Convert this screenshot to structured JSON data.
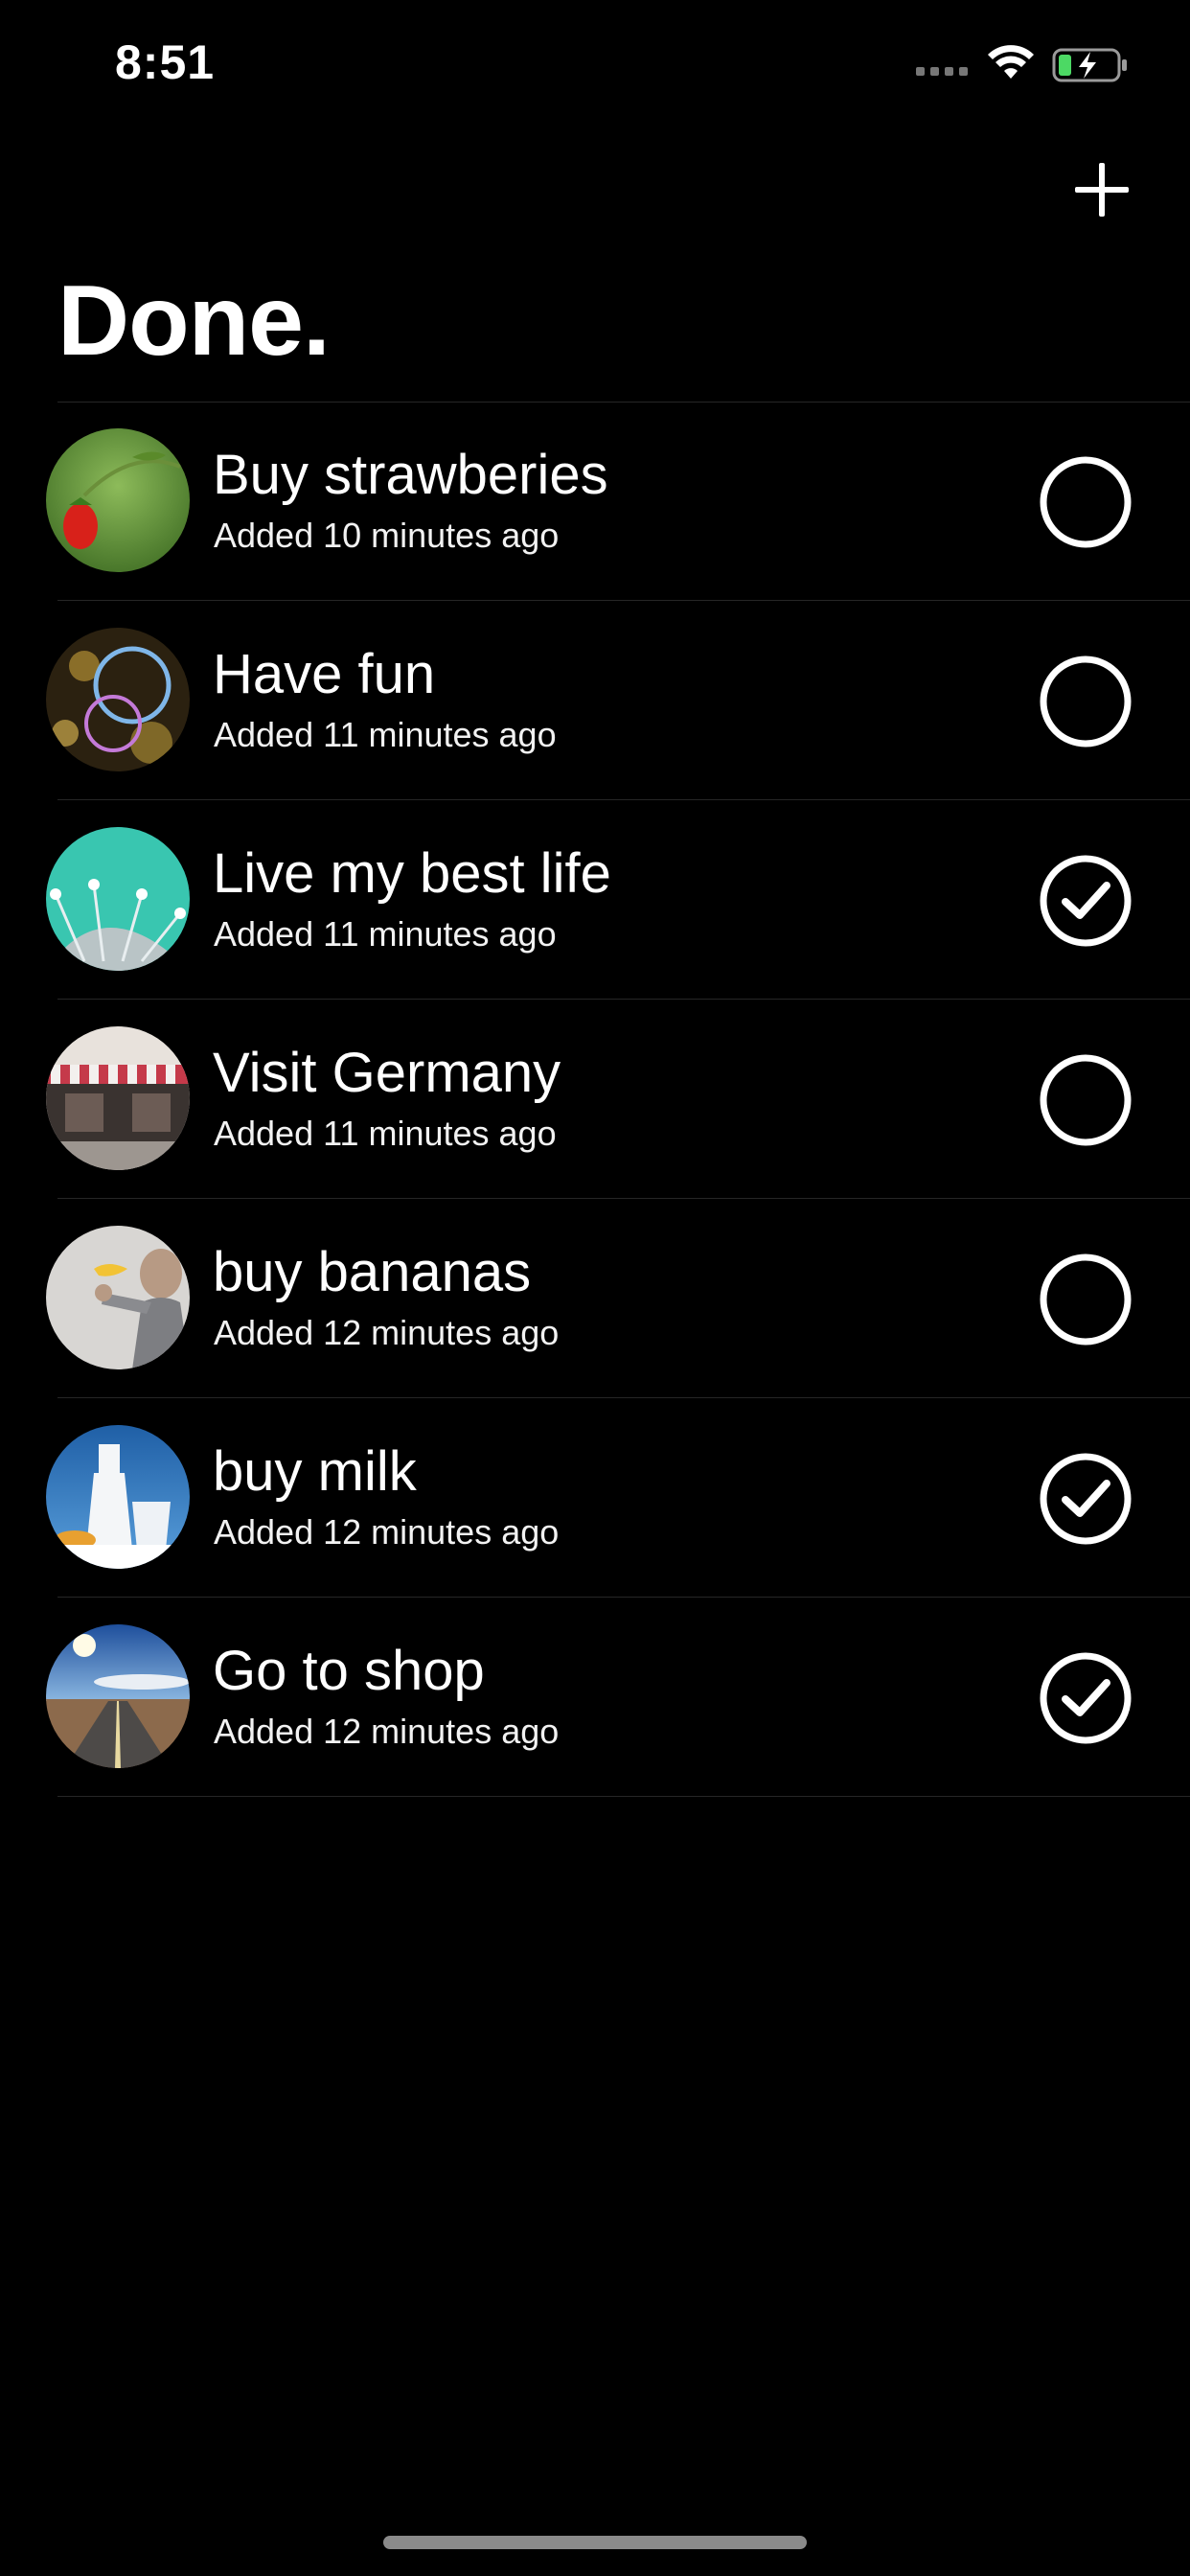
{
  "status_bar": {
    "time": "8:51"
  },
  "header": {
    "title": "Done.",
    "add_icon": "plus-icon"
  },
  "items": [
    {
      "title": "Buy strawberies",
      "subtitle": "Added 10 minutes ago",
      "done": false,
      "thumbnail": "strawberry-photo"
    },
    {
      "title": "Have fun",
      "subtitle": "Added 11 minutes ago",
      "done": false,
      "thumbnail": "soap-bubbles-photo"
    },
    {
      "title": "Live my best life",
      "subtitle": "Added 11 minutes ago",
      "done": true,
      "thumbnail": "dandelion-dew-photo"
    },
    {
      "title": "Visit Germany",
      "subtitle": "Added 11 minutes ago",
      "done": false,
      "thumbnail": "storefront-photo"
    },
    {
      "title": "buy bananas",
      "subtitle": "Added 12 minutes ago",
      "done": false,
      "thumbnail": "man-with-banana-photo"
    },
    {
      "title": "buy milk",
      "subtitle": "Added 12 minutes ago",
      "done": true,
      "thumbnail": "milk-bottles-photo"
    },
    {
      "title": "Go to shop",
      "subtitle": "Added 12 minutes ago",
      "done": true,
      "thumbnail": "desert-road-photo"
    }
  ],
  "colors": {
    "background": "#000000",
    "text": "#ffffff",
    "divider": "#262626",
    "battery_charge": "#4cd964"
  }
}
